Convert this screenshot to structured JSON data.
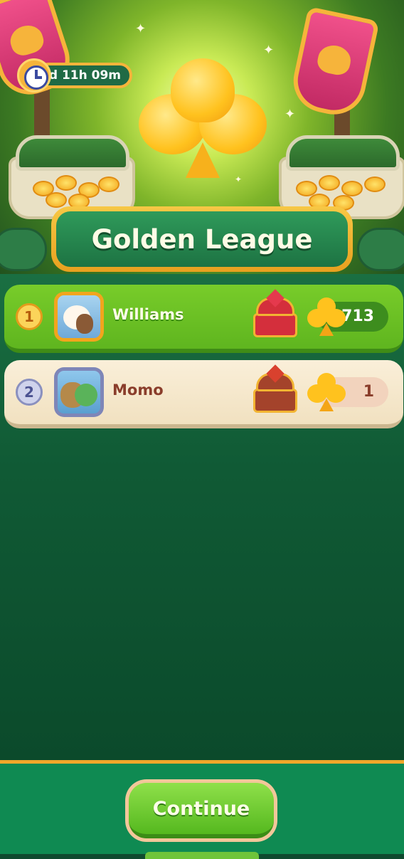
{
  "event": {
    "timer": "2d 11h 09m",
    "title": "Golden League"
  },
  "leaderboard": [
    {
      "rank": "1",
      "name": "Williams",
      "score": "713",
      "avatar": "sheep-and-bear-avatar",
      "reward": "red-treasure-chest-icon"
    },
    {
      "rank": "2",
      "name": "Momo",
      "score": "1",
      "avatar": "turtle-avatar",
      "reward": "brown-treasure-chest-icon"
    }
  ],
  "footer": {
    "continue_label": "Continue"
  },
  "colors": {
    "gold": "#f6b43b",
    "green_board": "#105a35",
    "first_row": "#6cc124",
    "second_row": "#f6e9cd",
    "button_green": "#6fcb32"
  }
}
